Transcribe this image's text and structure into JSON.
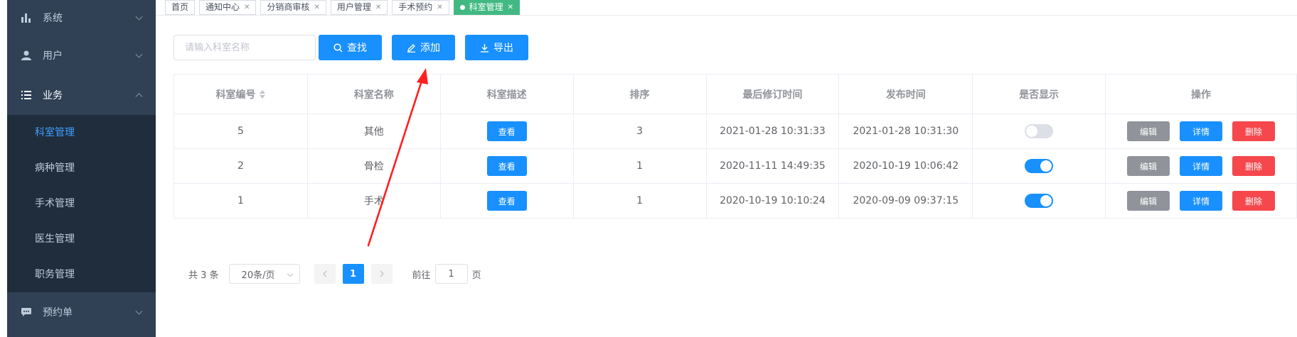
{
  "sidebar": {
    "items": [
      {
        "label": "系统",
        "icon": "bar-chart-icon"
      },
      {
        "label": "用户",
        "icon": "user-icon"
      },
      {
        "label": "业务",
        "icon": "list-icon"
      }
    ],
    "sub_items": [
      "科室管理",
      "病种管理",
      "手术管理",
      "医生管理",
      "职务管理"
    ],
    "bottom_item": {
      "label": "预约单",
      "icon": "chat-icon"
    }
  },
  "tags": [
    {
      "label": "首页",
      "closable": false
    },
    {
      "label": "通知中心",
      "closable": true
    },
    {
      "label": "分销商审核",
      "closable": true
    },
    {
      "label": "用户管理",
      "closable": true
    },
    {
      "label": "手术预约",
      "closable": true
    },
    {
      "label": "科室管理",
      "closable": true,
      "active": true
    }
  ],
  "toolbar": {
    "search_placeholder": "请输入科室名称",
    "search_label": "查找",
    "add_label": "添加",
    "export_label": "导出"
  },
  "table": {
    "headers": [
      "科室编号",
      "科室名称",
      "科室描述",
      "排序",
      "最后修订时间",
      "发布时间",
      "是否显示",
      "操作"
    ],
    "view_label": "查看",
    "edit_label": "编辑",
    "detail_label": "详情",
    "delete_label": "删除",
    "rows": [
      {
        "id": "5",
        "name": "其他",
        "sort": "3",
        "updated": "2021-01-28 10:31:33",
        "published": "2021-01-28 10:31:30",
        "visible": false
      },
      {
        "id": "2",
        "name": "骨检",
        "sort": "1",
        "updated": "2020-11-11 14:49:35",
        "published": "2020-10-19 10:06:42",
        "visible": true
      },
      {
        "id": "1",
        "name": "手术",
        "sort": "1",
        "updated": "2020-10-19 10:10:24",
        "published": "2020-09-09 09:37:15",
        "visible": true
      }
    ]
  },
  "pagination": {
    "total_label": "共 3 条",
    "page_size": "20条/页",
    "current_page": "1",
    "goto_label": "前往",
    "goto_value": "1",
    "page_suffix": "页"
  },
  "colors": {
    "primary": "#1890ff",
    "danger": "#f5474c",
    "active_tag": "#42b983",
    "sidebar_bg": "#304156",
    "arrow": "#ff1f1f"
  }
}
